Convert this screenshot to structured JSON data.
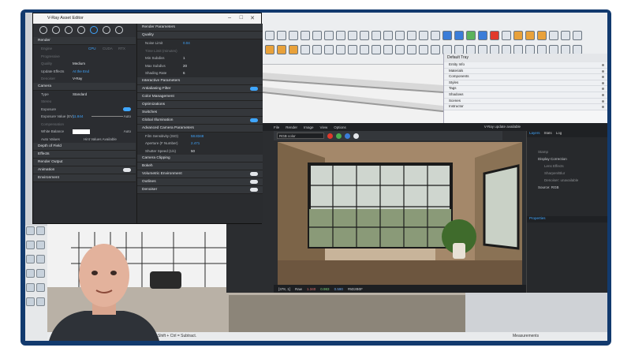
{
  "asset_editor": {
    "title": "V-Ray Asset Editor",
    "left": {
      "render_header": "Render",
      "engine_label": "Engine",
      "engine_options": [
        "CPU",
        "CUDA",
        "RTX"
      ],
      "progressive_label": "Progressive",
      "quality_label": "Quality",
      "quality_value": "Medium",
      "update_effects_label": "Update Effects",
      "update_effects_value": "At the End",
      "denoiser_label": "Denoiser",
      "denoiser_value": "V-Ray",
      "camera_header": "Camera",
      "type_label": "Type",
      "type_value": "Standard",
      "stereo_label": "Stereo",
      "exposure_label": "Exposure",
      "exposure_value_label": "Exposure Value (EV)",
      "exposure_value": "11.844",
      "exposure_mode": "Auto",
      "compensation_label": "Compensation",
      "white_balance_label": "White Balance",
      "white_balance_mode": "Auto",
      "auto_values_label": "Auto Values",
      "hint_values_label": "Hint Values Available",
      "depth_of_field_label": "Depth of Field",
      "effects_label": "Effects",
      "render_output_label": "Render Output",
      "animation_label": "Animation",
      "environment_label": "Environment"
    },
    "right": {
      "render_parameters_header": "Render Parameters",
      "quality_header": "Quality",
      "noise_limit_label": "Noise Limit",
      "noise_limit_value": "0.04",
      "time_limit_label": "Time Limit (minutes)",
      "min_subdivs_label": "Min Subdivs",
      "min_subdivs_value": "1",
      "max_subdivs_label": "Max Subdivs",
      "max_subdivs_value": "20",
      "shading_rate_label": "Shading Rate",
      "shading_rate_value": "6",
      "interactive_parameters_label": "Interactive Parameters",
      "antialiasing_filter_label": "Antialiasing Filter",
      "color_management_label": "Color Management",
      "optimizations_label": "Optimizations",
      "switches_label": "Switches",
      "global_illumination_label": "Global Illumination",
      "advanced_camera_label": "Advanced Camera Parameters",
      "film_sensitivity_label": "Film Sensitivity (ISO)",
      "film_sensitivity_value": "58.8348",
      "aperture_label": "Aperture (F Number)",
      "aperture_value": "2.471",
      "shutter_speed_label": "Shutter Speed (1/s)",
      "shutter_speed_value": "50",
      "camera_clipping_label": "Camera Clipping",
      "bokeh_label": "Bokeh",
      "volumetric_environment_label": "Volumetric Environment",
      "outlines_label": "Outlines",
      "denoiser_label": "Denoiser"
    }
  },
  "default_tray": {
    "title": "Default Tray",
    "items": [
      "Entity Info",
      "Materials",
      "Components",
      "Styles",
      "Tags",
      "Shadows",
      "Scenes",
      "Instructor"
    ]
  },
  "frame_buffer": {
    "menu": [
      "File",
      "Render",
      "Image",
      "View",
      "Options"
    ],
    "update_notice": "V-Ray update available",
    "channel": "RGB color",
    "status_coords": "[378, 1]",
    "status_raw": "Raw",
    "status_values": [
      "1.340",
      "0.983",
      "0.590"
    ],
    "status_hex": "#5D2B0F",
    "layers_tabs": [
      "Layers",
      "Stats",
      "Log"
    ],
    "layers": [
      "Stamp",
      "Display Correction",
      "Lens Effects",
      "Sharpen/Blur",
      "Denoiser: unavailable",
      "Source: RGB"
    ],
    "properties_label": "Properties"
  },
  "status_bar": {
    "hint": "Shift + Ctrl = Subtract.",
    "measurements_label": "Measurements"
  },
  "colors": {
    "accent": "#3fa6ff",
    "panel_bg": "#2a2c2f",
    "frame_border": "#123a6e"
  }
}
